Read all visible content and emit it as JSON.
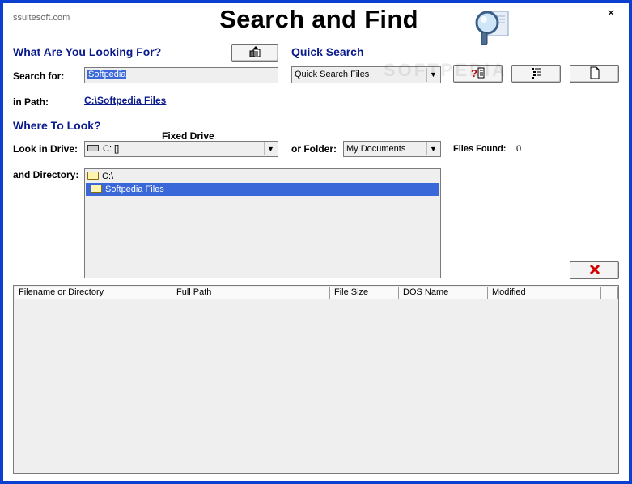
{
  "window": {
    "brand": "ssuitesoft.com",
    "title": "Search and Find",
    "minimize_label": "_",
    "close_label": "✕",
    "accent_color": "#0a3fd0"
  },
  "search_section": {
    "heading": "What Are You Looking For?",
    "search_for_label": "Search for:",
    "search_for_value": "Softpedia",
    "in_path_label": "in Path:",
    "in_path_value": "C:\\Softpedia Files"
  },
  "quick_search": {
    "heading": "Quick Search",
    "combo_value": "Quick Search Files",
    "icons": [
      "help-icon",
      "list-icon",
      "document-icon"
    ]
  },
  "where_section": {
    "heading": "Where To Look?",
    "drive_type_label": "Fixed Drive",
    "look_in_drive_label": "Look in Drive:",
    "drive_value": "C: []",
    "or_folder_label": "or Folder:",
    "folder_value": "My Documents",
    "files_found_label": "Files Found:",
    "files_found_value": "0",
    "directory_label": "and Directory:",
    "tree": [
      {
        "label": "C:\\",
        "selected": false
      },
      {
        "label": "Softpedia Files",
        "selected": true
      }
    ]
  },
  "results": {
    "columns": [
      "Filename or Directory",
      "Full Path",
      "File Size",
      "DOS Name",
      "Modified"
    ],
    "rows": []
  },
  "watermark": "SOFTPEDIA"
}
